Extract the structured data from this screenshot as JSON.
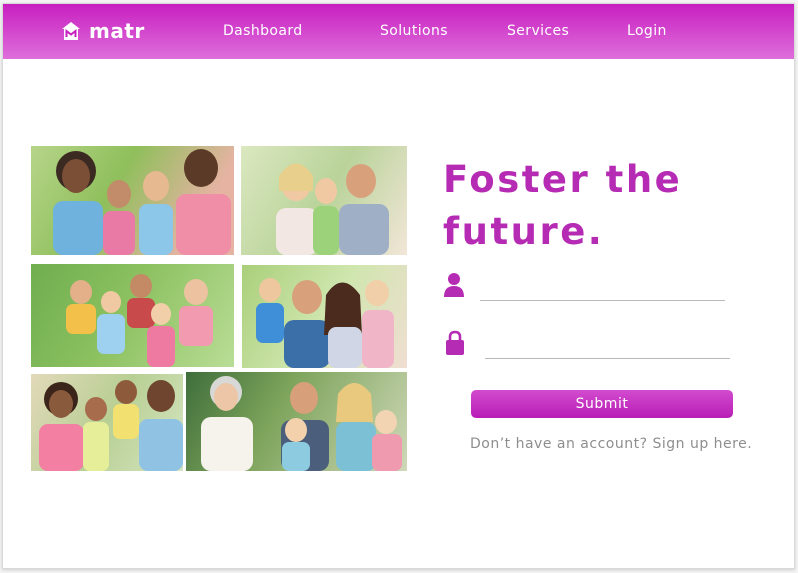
{
  "brand": {
    "name": "matr",
    "logo_icon": "house-m-icon"
  },
  "nav": {
    "items": [
      {
        "label": "Dashboard"
      },
      {
        "label": "Solutions"
      },
      {
        "label": "Services"
      },
      {
        "label": "Login"
      }
    ]
  },
  "hero": {
    "headline": "Foster the future."
  },
  "form": {
    "username": {
      "icon": "user-icon",
      "value": "",
      "placeholder": ""
    },
    "password": {
      "icon": "lock-icon",
      "value": "",
      "placeholder": ""
    },
    "submit_label": "Submit",
    "signup_text": "Don’t have an account? Sign up here."
  },
  "collage": {
    "photos": [
      {
        "name": "family-photo-1"
      },
      {
        "name": "family-photo-2"
      },
      {
        "name": "family-photo-3"
      },
      {
        "name": "family-photo-4"
      },
      {
        "name": "family-photo-5"
      },
      {
        "name": "family-photo-6"
      }
    ]
  },
  "colors": {
    "brand_magenta": "#c81fc0",
    "headline": "#b62bb3",
    "button": "#c935c6",
    "muted_text": "#8e8e8e"
  }
}
